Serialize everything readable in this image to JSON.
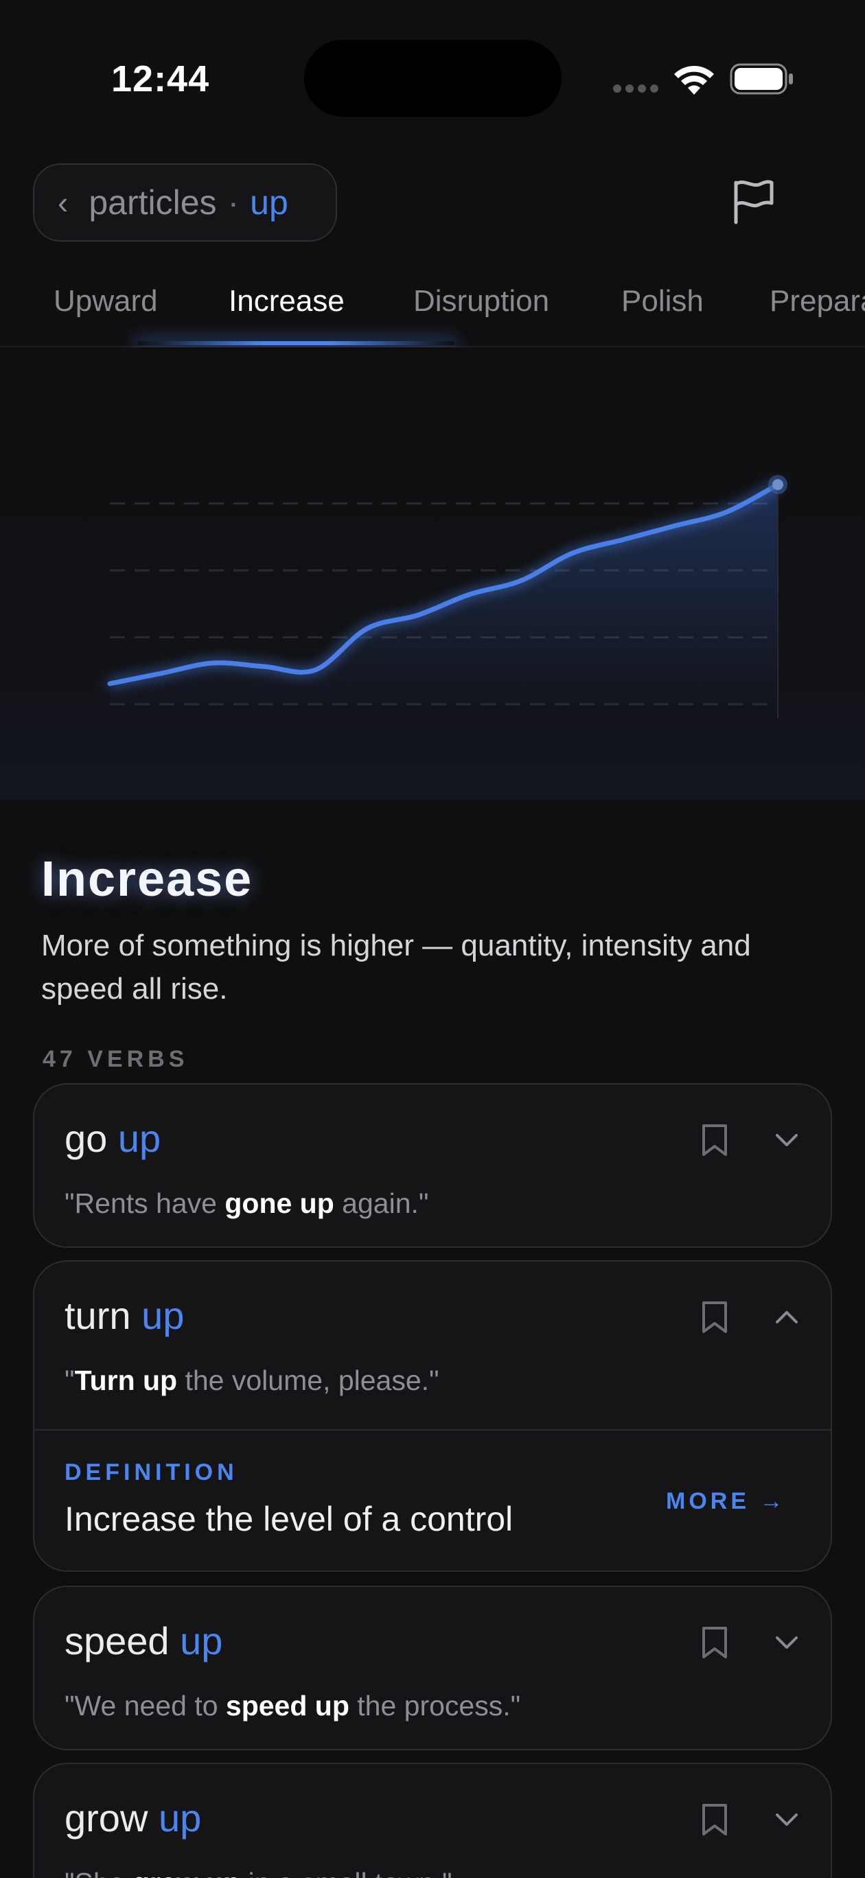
{
  "status_bar": {
    "time": "12:44"
  },
  "nav": {
    "breadcrumb_category": "particles",
    "breadcrumb_separator": "·",
    "breadcrumb_particle": "up",
    "back_icon": "chevron-left-icon",
    "flag_icon": "flag-icon"
  },
  "tabs": [
    {
      "label": "Upward"
    },
    {
      "label": "Increase"
    },
    {
      "label": "Disruption"
    },
    {
      "label": "Polish"
    },
    {
      "label": "Prepara"
    }
  ],
  "active_tab": "Increase",
  "colors": {
    "accent": "#4b86f0",
    "background": "#0f0f10",
    "card": "#151517"
  },
  "chart_data": {
    "type": "line",
    "title": "",
    "xlabel": "",
    "ylabel": "",
    "x": [
      0,
      1,
      2,
      3,
      4,
      5,
      6,
      7,
      8,
      9,
      10,
      11,
      12,
      13
    ],
    "series": [
      {
        "values": [
          10,
          13,
          16,
          15,
          14,
          26,
          30,
          36,
          40,
          48,
          52,
          56,
          60,
          68
        ]
      }
    ],
    "ylim": [
      0,
      78
    ],
    "grid": "horizontal-dashed",
    "legend": "none"
  },
  "section": {
    "title": "Increase",
    "description": "More of something is higher — quantity, intensity and speed all rise.",
    "count_label": "47 VERBS"
  },
  "verbs": [
    {
      "verb": "go",
      "particle": "up",
      "example_pre": "\"Rents have ",
      "example_bold": "gone up",
      "example_post": " again.\"",
      "expanded": false
    },
    {
      "verb": "turn",
      "particle": "up",
      "example_pre": "\"",
      "example_bold": "Turn up",
      "example_post": " the volume, please.\"",
      "expanded": true,
      "definition_label": "DEFINITION",
      "definition": "Increase the level of a control",
      "more_label": "MORE →"
    },
    {
      "verb": "speed",
      "particle": "up",
      "example_pre": "\"We need to ",
      "example_bold": "speed up",
      "example_post": " the process.\"",
      "expanded": false
    },
    {
      "verb": "grow",
      "particle": "up",
      "example_pre": "\"She ",
      "example_bold": "grew up",
      "example_post": " in a small town.\"",
      "expanded": false
    }
  ]
}
